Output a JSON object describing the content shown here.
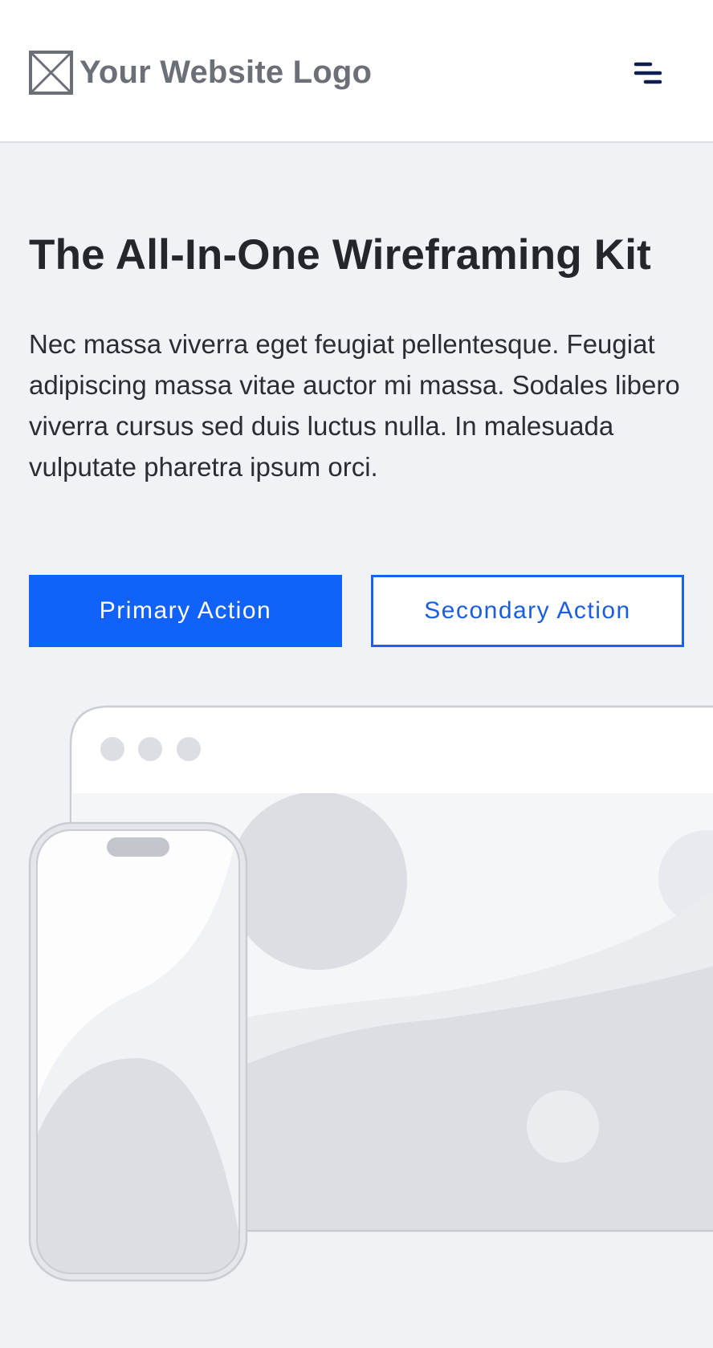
{
  "header": {
    "logo_text": "Your Website Logo",
    "logo_icon": "image-placeholder-icon",
    "menu_icon": "hamburger-menu-icon"
  },
  "hero": {
    "title": "The All-In-One Wireframing Kit",
    "body": "Nec massa viverra eget feugiat pellentesque. Feugiat adipiscing massa vitae auctor mi massa. Sodales libero viverra cursus sed duis luctus nulla. In malesuada vulputate pharetra ipsum orci."
  },
  "actions": {
    "primary_label": "Primary Action",
    "secondary_label": "Secondary Action"
  },
  "colors": {
    "accent": "#1162fb",
    "background": "#f1f2f6",
    "header_background": "#ffffff",
    "heading_text": "#23272b",
    "logo_text": "#6a6f78",
    "menu_icon": "#0f1f4d"
  },
  "illustration": {
    "browser_icons": [
      "window-dot-icon",
      "window-dot-icon",
      "window-dot-icon"
    ],
    "phone_icon": "mobile-phone-icon"
  }
}
